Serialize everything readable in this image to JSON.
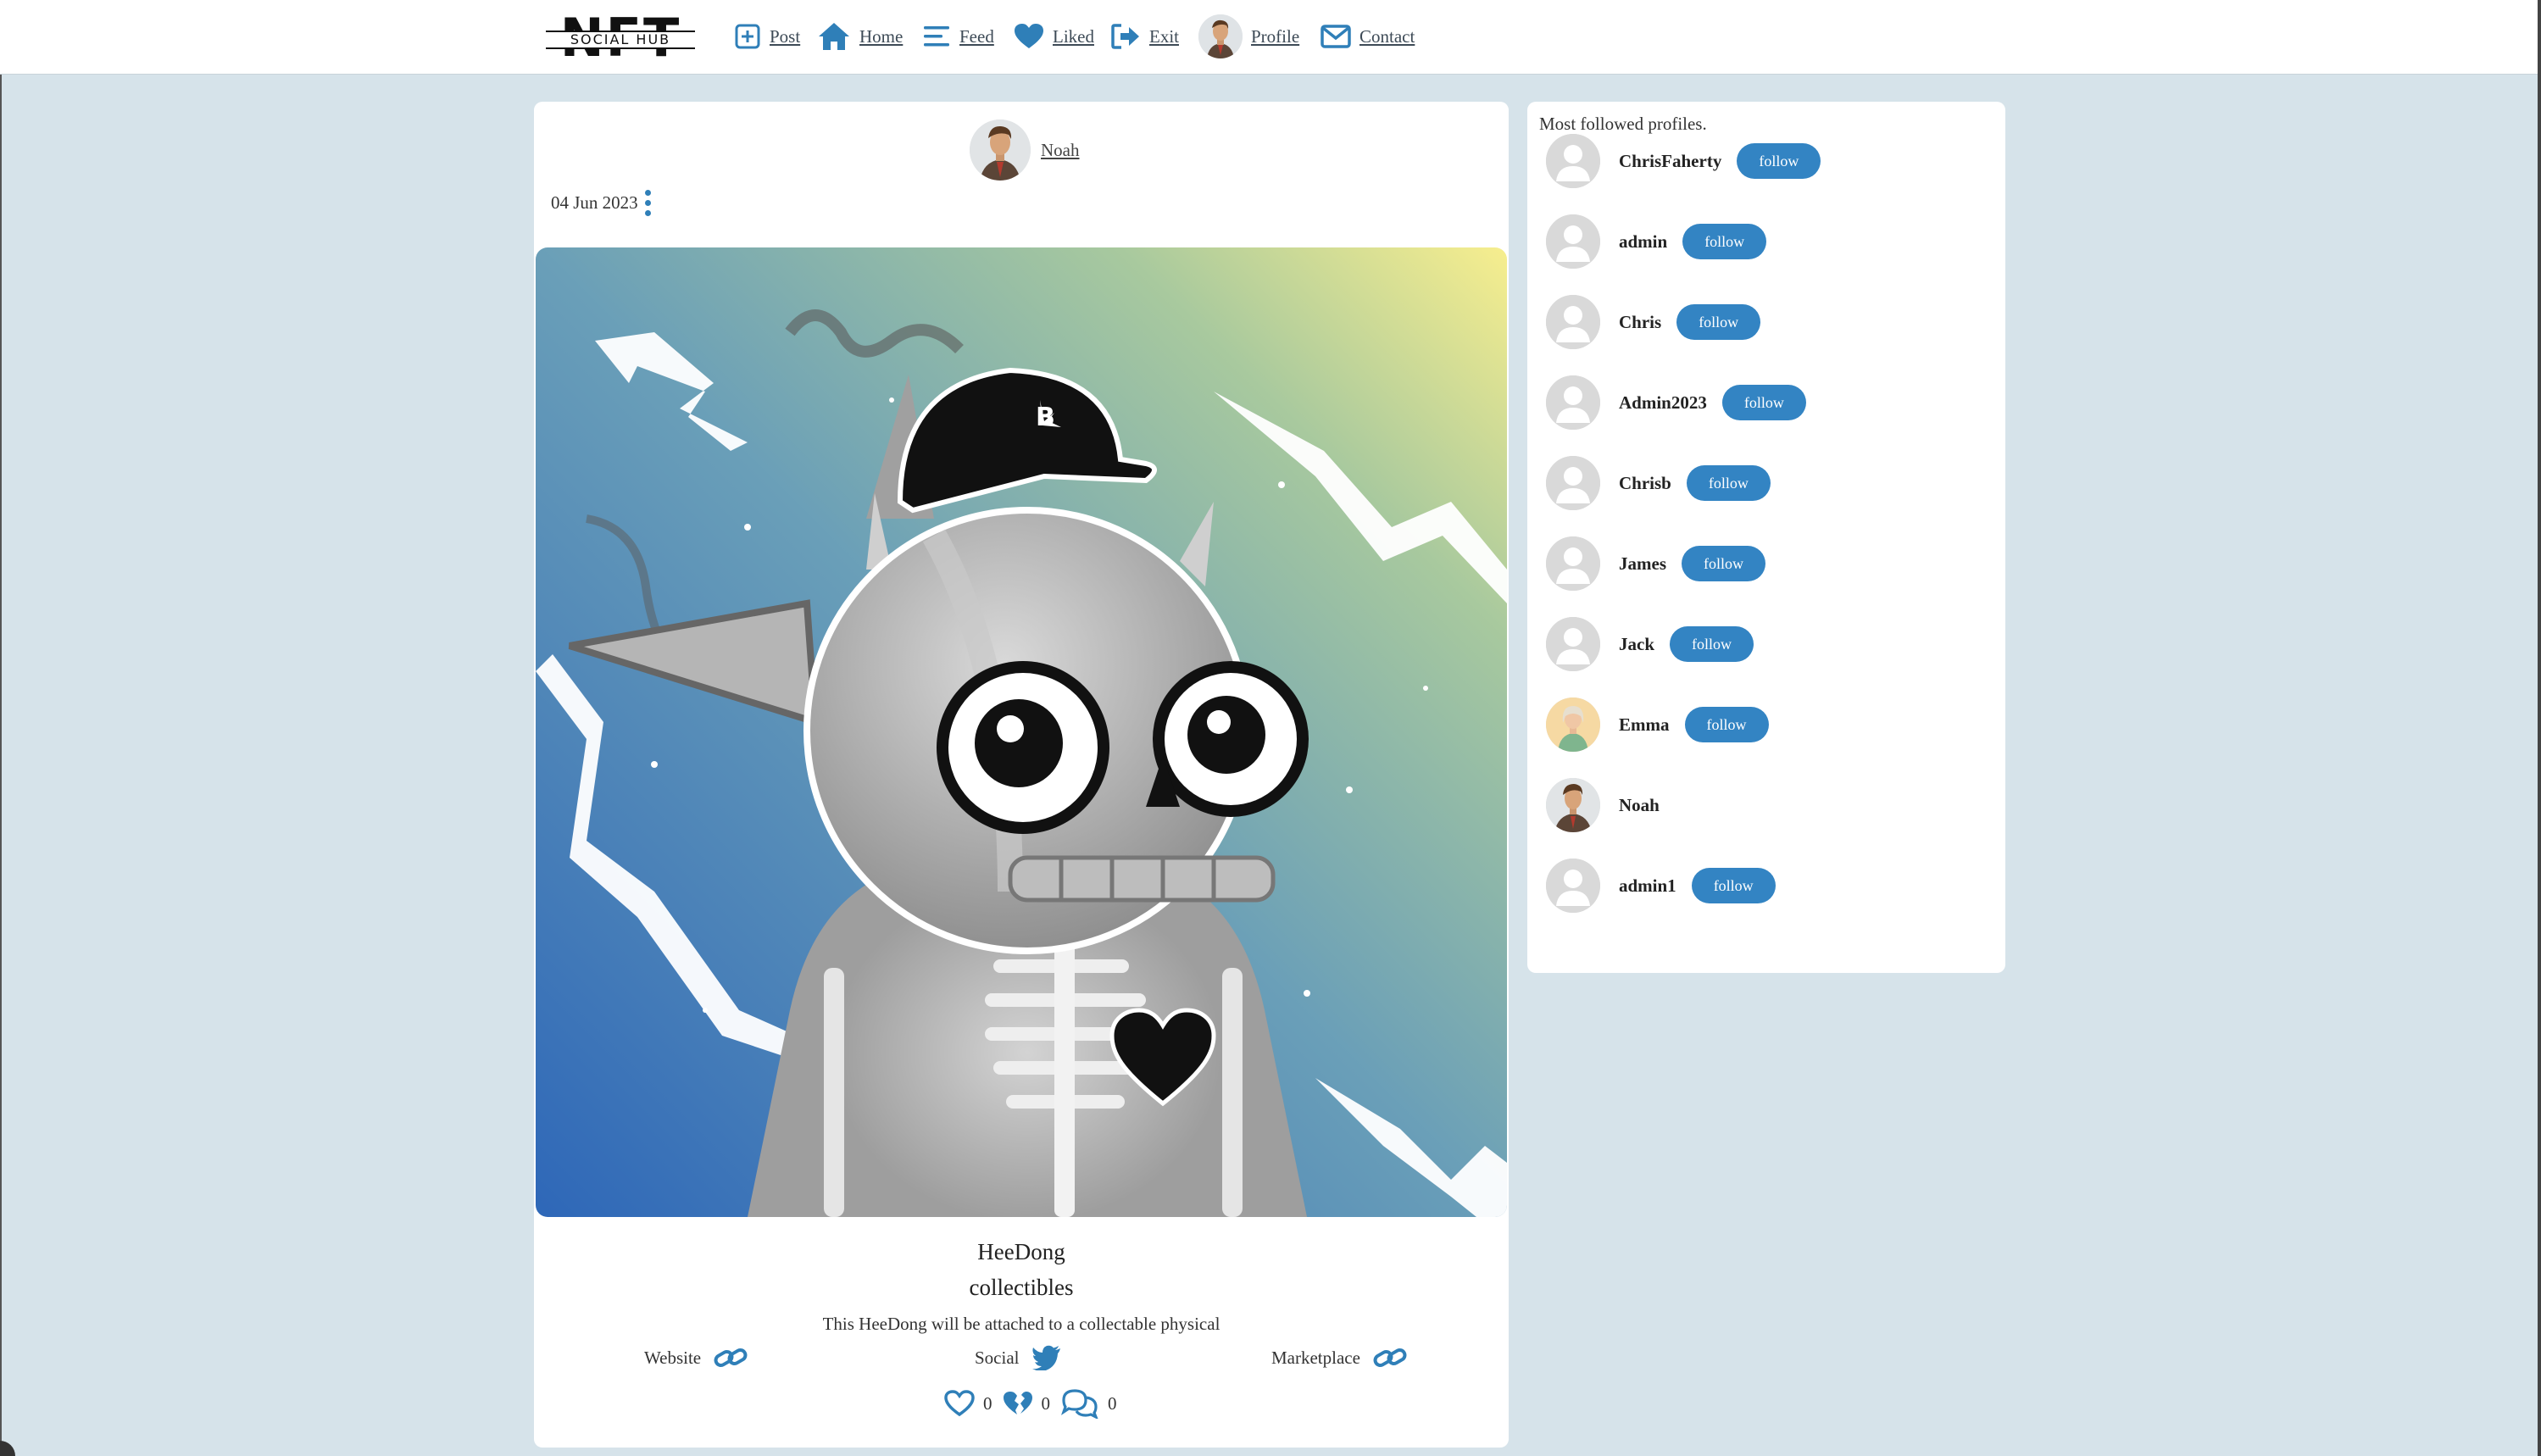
{
  "nav": {
    "logo_text": "NFT",
    "logo_subtext": "SOCIAL HUB",
    "items": [
      {
        "label": "Post",
        "icon": "plus-square-icon"
      },
      {
        "label": "Home",
        "icon": "home-icon"
      },
      {
        "label": "Feed",
        "icon": "list-icon"
      },
      {
        "label": "Liked",
        "icon": "heart-icon"
      },
      {
        "label": "Exit",
        "icon": "exit-icon"
      },
      {
        "label": "Profile",
        "icon": "avatar"
      },
      {
        "label": "Contact",
        "icon": "envelope-icon"
      }
    ]
  },
  "post": {
    "author": "Noah",
    "date": "04 Jun 2023",
    "title": "HeeDong",
    "category": "collectibles",
    "description": "This HeeDong will be attached to a collectable physical",
    "links": [
      {
        "label": "Website",
        "icon": "link-icon"
      },
      {
        "label": "Social",
        "icon": "twitter-icon"
      },
      {
        "label": "Marketplace",
        "icon": "link-icon"
      }
    ],
    "reactions": {
      "likes": "0",
      "dislikes": "0",
      "comments": "0"
    }
  },
  "sidebar": {
    "title": "Most followed profiles.",
    "follow_label": "follow",
    "profiles": [
      {
        "name": "ChrisFaherty",
        "followable": true
      },
      {
        "name": "admin",
        "followable": true
      },
      {
        "name": "Chris",
        "followable": true
      },
      {
        "name": "Admin2023",
        "followable": true
      },
      {
        "name": "Chrisb",
        "followable": true
      },
      {
        "name": "James",
        "followable": true
      },
      {
        "name": "Jack",
        "followable": true
      },
      {
        "name": "Emma",
        "followable": true
      },
      {
        "name": "Noah",
        "followable": false
      },
      {
        "name": "admin1",
        "followable": true
      }
    ]
  },
  "colors": {
    "accent": "#3384c3",
    "background": "#d6e3ea",
    "icon_blue": "#2f7fb8"
  }
}
